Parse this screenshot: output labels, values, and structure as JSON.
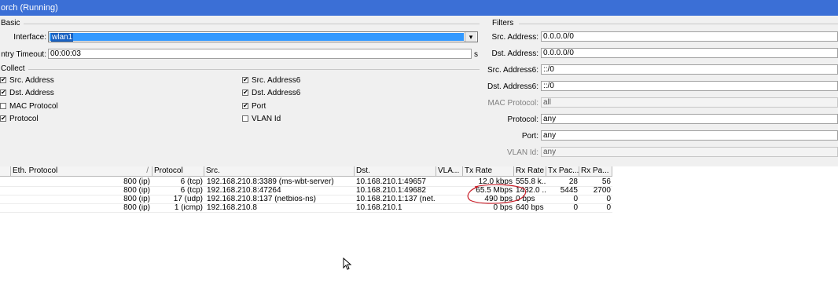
{
  "window": {
    "title": "orch (Running)"
  },
  "basic": {
    "group_label": "Basic",
    "interface_label": "Interface:",
    "interface_value": "wlan1",
    "interface_dropdown_glyph": "▾",
    "entry_timeout_label": "ntry Timeout:",
    "entry_timeout_value": "00:00:03",
    "entry_timeout_unit": "s"
  },
  "collect": {
    "group_label": "Collect",
    "items": [
      {
        "label": "Src. Address",
        "checked": true
      },
      {
        "label": "Dst. Address",
        "checked": true
      },
      {
        "label": "MAC Protocol",
        "checked": false
      },
      {
        "label": "Protocol",
        "checked": true
      },
      {
        "label": "Src. Address6",
        "checked": true
      },
      {
        "label": "Dst. Address6",
        "checked": true
      },
      {
        "label": "Port",
        "checked": true
      },
      {
        "label": "VLAN Id",
        "checked": false
      }
    ]
  },
  "filters": {
    "group_label": "Filters",
    "fields": [
      {
        "label": "Src. Address:",
        "value": "0.0.0.0/0",
        "disabled": false
      },
      {
        "label": "Dst. Address:",
        "value": "0.0.0.0/0",
        "disabled": false
      },
      {
        "label": "Src. Address6:",
        "value": "::/0",
        "disabled": false
      },
      {
        "label": "Dst. Address6:",
        "value": "::/0",
        "disabled": false
      },
      {
        "label": "MAC Protocol:",
        "value": "all",
        "disabled": true
      },
      {
        "label": "Protocol:",
        "value": "any",
        "disabled": false
      },
      {
        "label": "Port:",
        "value": "any",
        "disabled": false
      },
      {
        "label": "VLAN Id:",
        "value": "any",
        "disabled": true
      }
    ]
  },
  "table": {
    "columns": [
      "Eth. Protocol",
      "Protocol",
      "Src.",
      "Dst.",
      "VLA...",
      "Tx Rate",
      "Rx Rate",
      "Tx Pac...",
      "Rx Pa..."
    ],
    "rows": [
      [
        "800 (ip)",
        "6 (tcp)",
        "192.168.210.8:3389 (ms-wbt-server)",
        "10.168.210.1:49657",
        "",
        "12.0 kbps",
        "555.8 k...",
        "28",
        "56"
      ],
      [
        "800 (ip)",
        "6 (tcp)",
        "192.168.210.8:47264",
        "10.168.210.1:49682",
        "",
        "65.5 Mbps",
        "1432.0 ...",
        "5445",
        "2700"
      ],
      [
        "800 (ip)",
        "17 (udp)",
        "192.168.210.8:137 (netbios-ns)",
        "10.168.210.1:137 (net...",
        "",
        "490 bps",
        "0 bps",
        "0",
        "0"
      ],
      [
        "800 (ip)",
        "1 (icmp)",
        "192.168.210.8",
        "10.168.210.1",
        "",
        "0 bps",
        "640 bps",
        "0",
        "0"
      ]
    ]
  },
  "colors": {
    "titlebar": "#3b6fd6",
    "selection": "#3399ff",
    "annotation": "#c8202a"
  },
  "icons": {
    "sort_indicator": "/",
    "checkmark": "✔",
    "cursor": "mouse-pointer-icon"
  }
}
